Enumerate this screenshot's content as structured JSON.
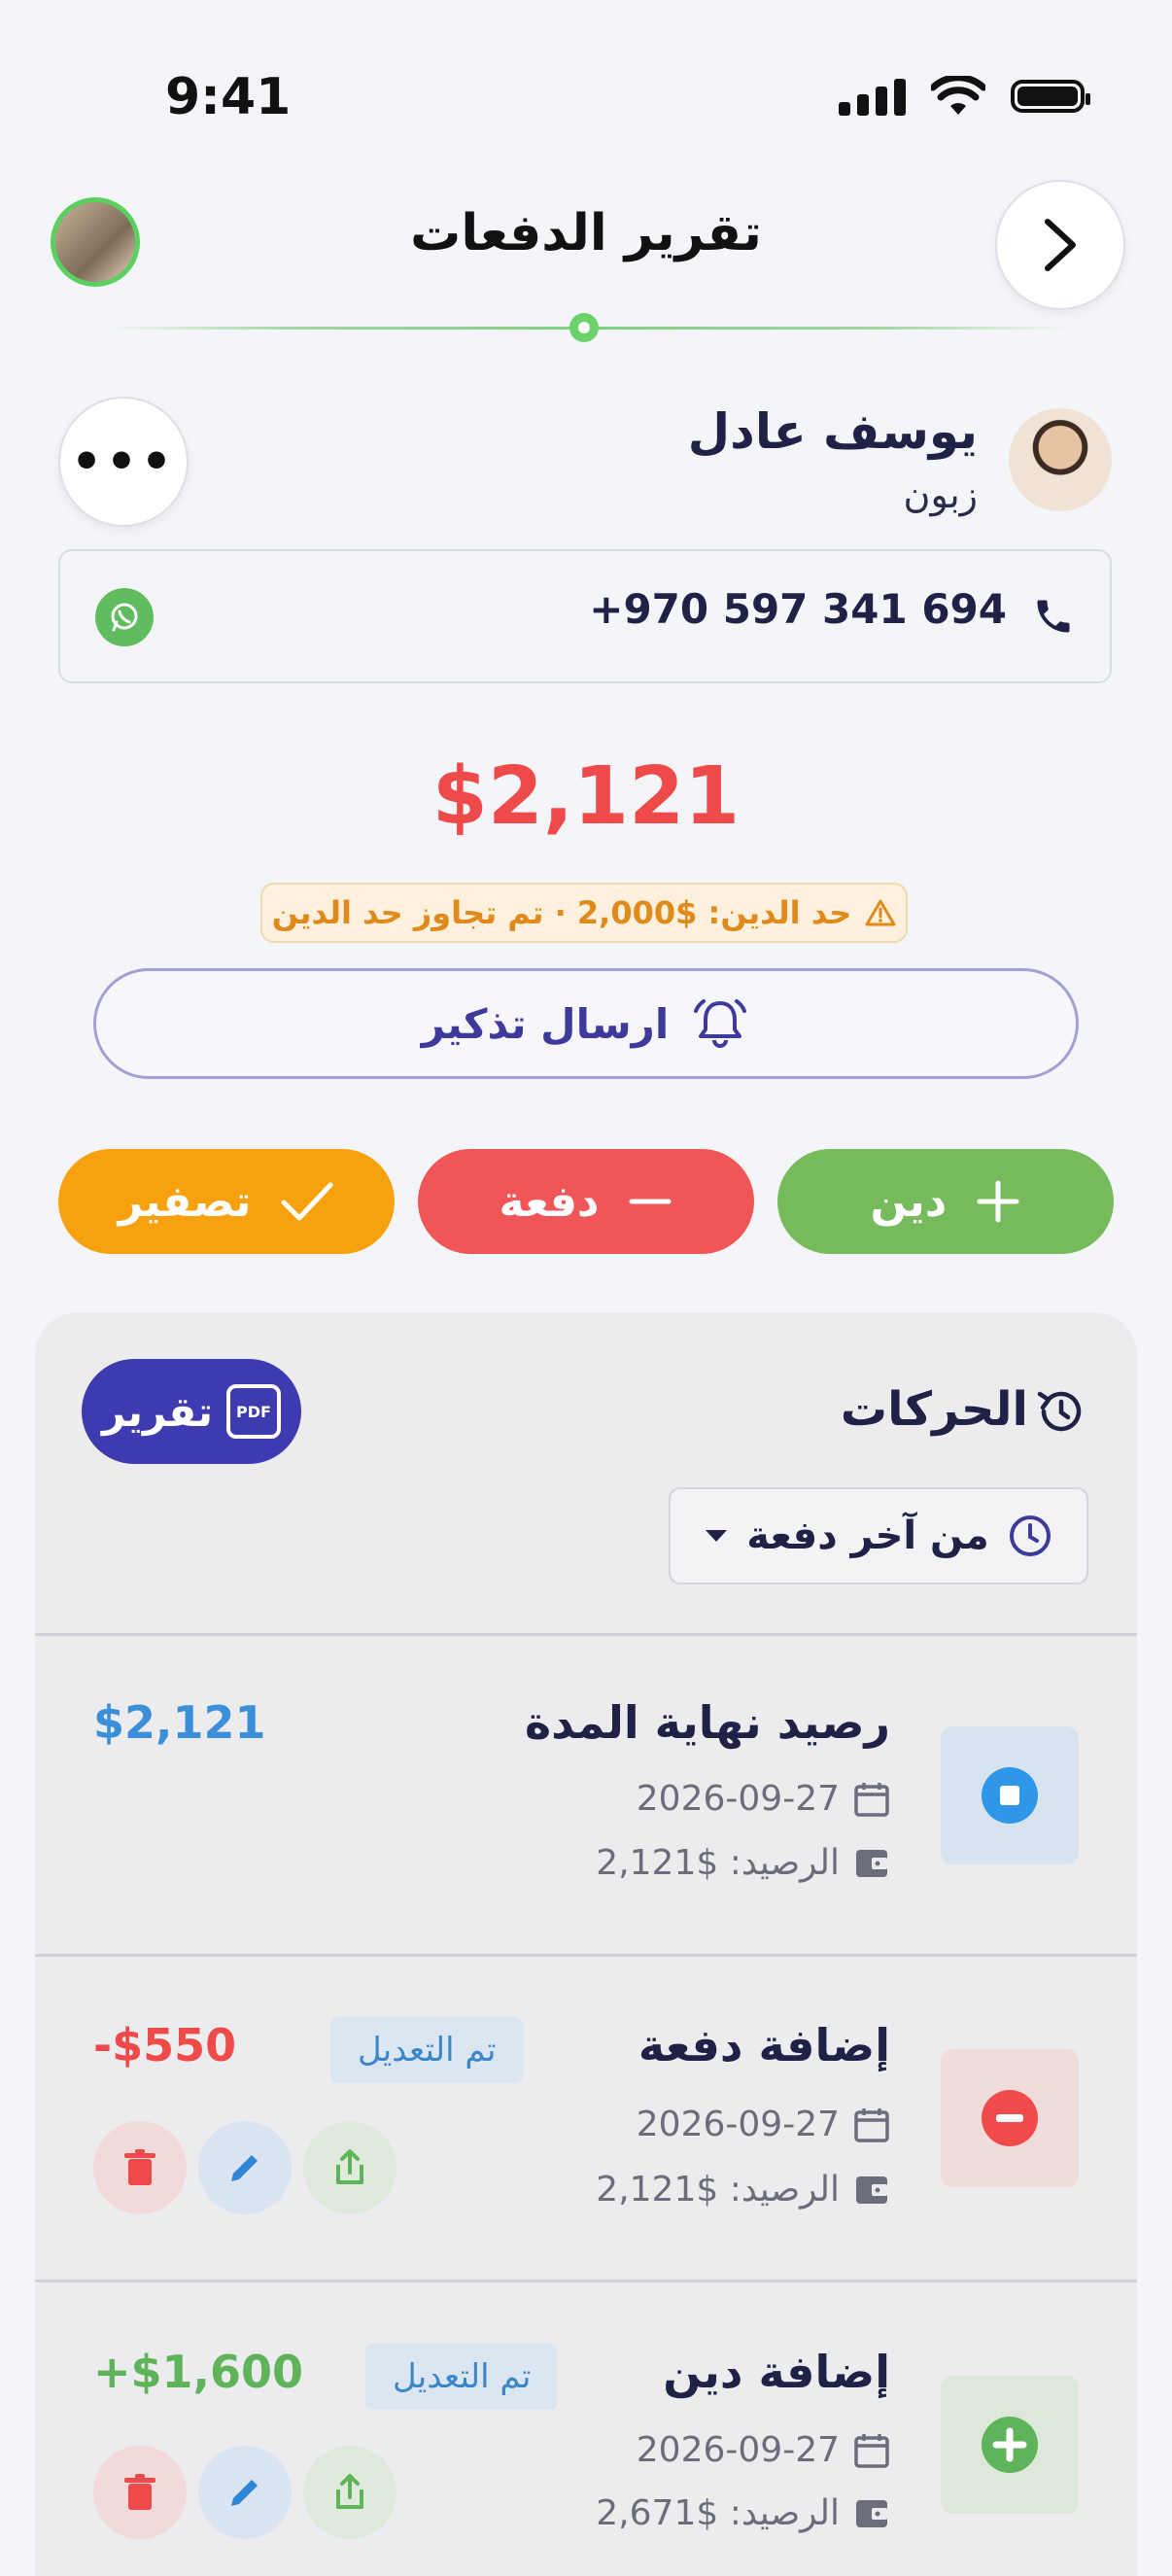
{
  "status_bar": {
    "time": "9:41"
  },
  "header": {
    "title": "تقرير الدفعات"
  },
  "customer": {
    "name": "يوسف عادل",
    "role": "زبون",
    "phone": "+970 597 341 694"
  },
  "balance": {
    "total": "$2,121",
    "warning": "حد الدين: $2,000 · تم تجاوز حد الدين"
  },
  "reminder": {
    "label": "ارسال تذكير"
  },
  "actions": {
    "debt": "دين",
    "payment": "دفعة",
    "zero": "تصفير"
  },
  "transactions": {
    "title": "الحركات",
    "pdf_label": "تقرير",
    "pdf_icon_text": "PDF",
    "filter": "من آخر دفعة",
    "items": [
      {
        "title": "رصيد نهاية المدة",
        "date": "2026-09-27",
        "balance": "الرصيد: $2,121",
        "amount": "$2,121",
        "amount_color": "#3a8fd8"
      },
      {
        "title": "إضافة دفعة",
        "date": "2026-09-27",
        "balance": "الرصيد: $2,121",
        "amount": "-$550",
        "amount_color": "#ef4a4a",
        "badge": "تم التعديل"
      },
      {
        "title": "إضافة دين",
        "date": "2026-09-27",
        "balance": "الرصيد: $2,671",
        "amount": "+$1,600",
        "amount_color": "#5fb35a",
        "badge": "تم التعديل"
      }
    ]
  }
}
